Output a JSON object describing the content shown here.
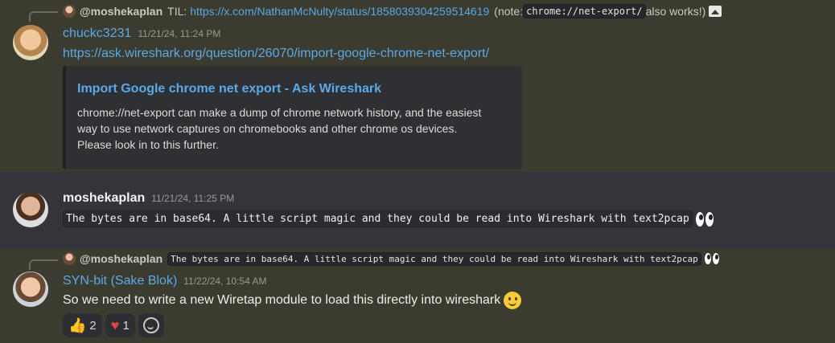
{
  "messages": [
    {
      "reply": {
        "author": "@moshekaplan",
        "text": "TIL: ",
        "link": "https://x.com/NathanMcNulty/status/1858039304259514619",
        "note_prefix": "(note: ",
        "note_code": "chrome://net-export/",
        "note_suffix": " also works!)",
        "attachment_icon": "image-icon"
      },
      "author": "chuckc3231",
      "timestamp": "11/21/24, 11:24 PM",
      "link": "https://ask.wireshark.org/question/26070/import-google-chrome-net-export/",
      "embed": {
        "title": "Import Google chrome net export - Ask Wireshark",
        "description_lines": [
          "chrome://net-export can make a dump of chrome network history, and the easiest",
          "way to use network captures on chromebooks and other chrome os devices.",
          "Please look in to this further."
        ]
      }
    },
    {
      "author": "moshekaplan",
      "timestamp": "11/21/24, 11:25 PM",
      "code_text": "The bytes are in base64. A little script magic and they could be read into Wireshark with text2pcap",
      "emoji": "eyes"
    },
    {
      "reply": {
        "author": "@moshekaplan",
        "code_text": "The bytes are in base64. A little script magic and they could be read into Wireshark with text2pcap",
        "emoji": "eyes"
      },
      "author": "SYN-bit (Sake Blok)",
      "timestamp": "11/22/24, 10:54 AM",
      "text": "So we need to write a new Wiretap module to load this directly into wireshark",
      "emoji": "slightly-smiling-face",
      "reactions": [
        {
          "emoji": "👍",
          "count": "2"
        },
        {
          "emoji": "♥",
          "count": "1"
        }
      ]
    }
  ],
  "colors": {
    "background": "#3c3b30",
    "highlight_row": "#34353b",
    "link": "#5aa9e8",
    "embed_bg": "#2f3034"
  }
}
